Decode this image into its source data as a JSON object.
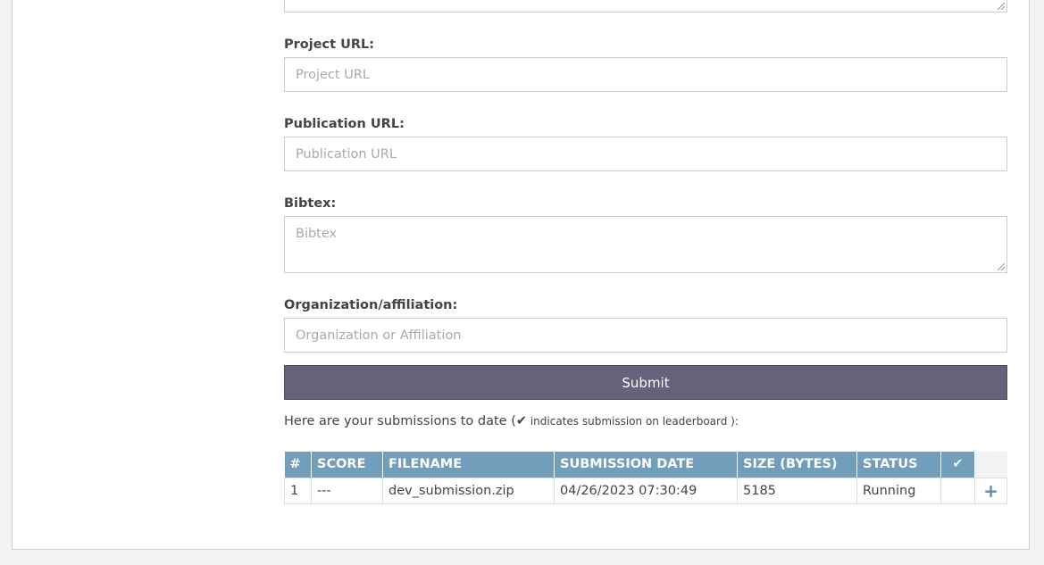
{
  "form": {
    "project_url": {
      "label": "Project URL:",
      "placeholder": "Project URL",
      "value": ""
    },
    "publication_url": {
      "label": "Publication URL:",
      "placeholder": "Publication URL",
      "value": ""
    },
    "bibtex": {
      "label": "Bibtex:",
      "placeholder": "Bibtex",
      "value": ""
    },
    "organization": {
      "label": "Organization/affiliation:",
      "placeholder": "Organization or Affiliation",
      "value": ""
    },
    "submit_label": "Submit"
  },
  "submissions": {
    "intro_text": "Here are your submissions to date (",
    "check_glyph": "✔",
    "intro_note": " indicates submission on leaderboard ",
    "intro_close": "):",
    "columns": [
      "#",
      "SCORE",
      "FILENAME",
      "SUBMISSION DATE",
      "SIZE (BYTES)",
      "STATUS",
      "✔"
    ],
    "rows": [
      {
        "num": "1",
        "score": "---",
        "filename": "dev_submission.zip",
        "date": "04/26/2023 07:30:49",
        "size": "5185",
        "status": "Running",
        "action": "+"
      }
    ]
  },
  "colors": {
    "header_bg": "#729ebb",
    "submit_bg": "#66627a"
  },
  "icons": {
    "check": "checkmark-icon",
    "expand": "plus-icon"
  }
}
